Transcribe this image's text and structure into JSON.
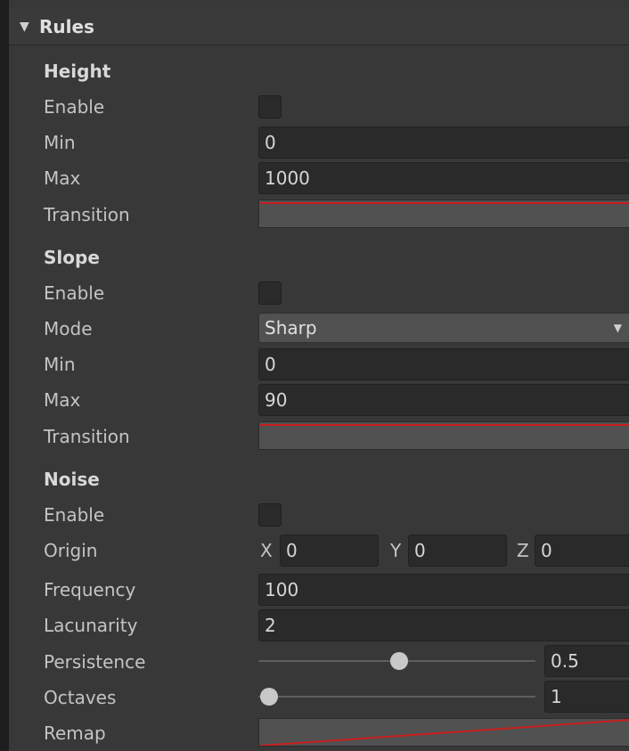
{
  "header": {
    "title": "Rules"
  },
  "height": {
    "section": "Height",
    "enable_label": "Enable",
    "enabled": false,
    "min_label": "Min",
    "min_value": "0",
    "max_label": "Max",
    "max_value": "1000",
    "transition_label": "Transition"
  },
  "slope": {
    "section": "Slope",
    "enable_label": "Enable",
    "enabled": false,
    "mode_label": "Mode",
    "mode_value": "Sharp",
    "min_label": "Min",
    "min_value": "0",
    "max_label": "Max",
    "max_value": "90",
    "transition_label": "Transition"
  },
  "noise": {
    "section": "Noise",
    "enable_label": "Enable",
    "enabled": false,
    "origin_label": "Origin",
    "origin": {
      "x_label": "X",
      "x": "0",
      "y_label": "Y",
      "y": "0",
      "z_label": "Z",
      "z": "0"
    },
    "frequency_label": "Frequency",
    "frequency_value": "100",
    "lacunarity_label": "Lacunarity",
    "lacunarity_value": "2",
    "persistence_label": "Persistence",
    "persistence_value": "0.5",
    "persistence_fraction": 0.5,
    "octaves_label": "Octaves",
    "octaves_value": "1",
    "octaves_fraction": 0.0,
    "remap_label": "Remap"
  },
  "colors": {
    "curve": "#c81e1e",
    "panel": "#383838",
    "field": "#2a2a2a"
  },
  "icons": {
    "foldout": "triangle-down-icon",
    "dropdown": "caret-down-icon"
  }
}
